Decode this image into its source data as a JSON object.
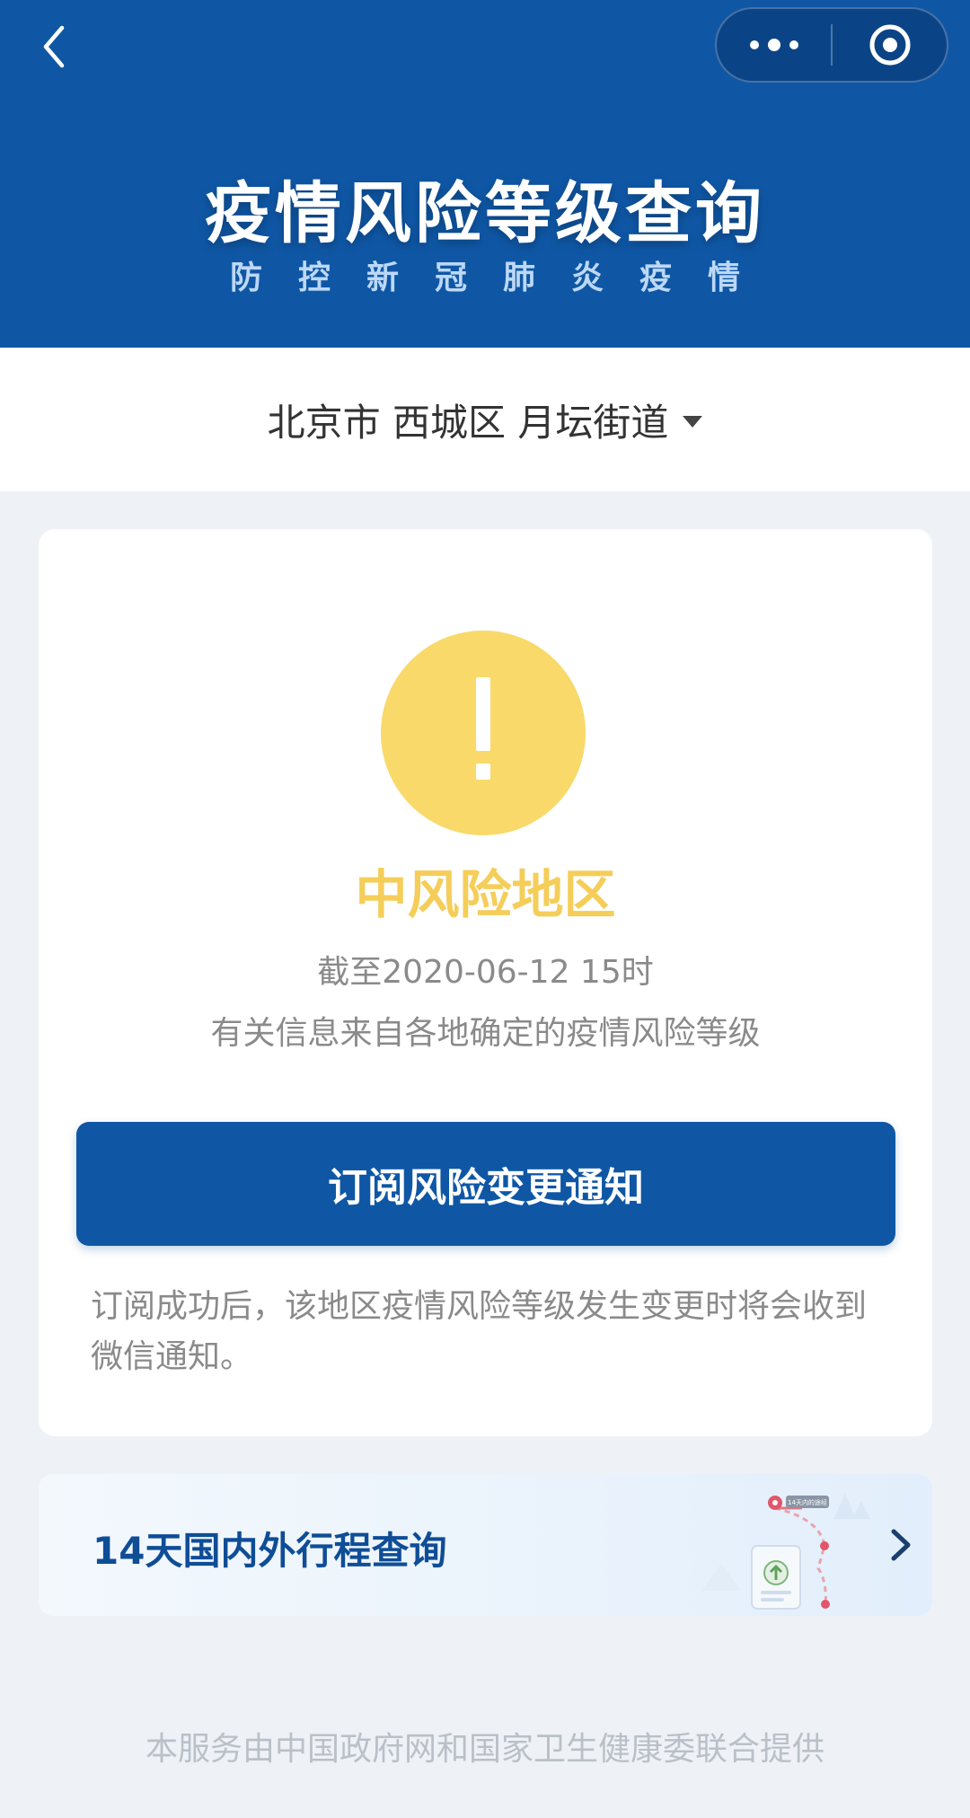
{
  "header": {
    "title": "疫情风险等级查询",
    "subtitle": "防控新冠肺炎疫情"
  },
  "nav": {
    "back_icon": "chevron-left-icon",
    "more_icon": "more-dots-icon",
    "close_icon": "target-circle-icon"
  },
  "region": {
    "label": "北京市 西城区 月坛街道",
    "dropdown_icon": "caret-down-icon"
  },
  "status_card": {
    "icon": "exclamation-icon",
    "risk_level": "中风险地区",
    "update_time": "截至2020-06-12 15时",
    "source_note": "有关信息来自各地确定的疫情风险等级",
    "subscribe_button": "订阅风险变更通知",
    "subscribe_note": "订阅成功后，该地区疫情风险等级发生变更时将会收到微信通知。",
    "colors": {
      "warning": "#f8d96a",
      "risk_text": "#f5cd59",
      "primary": "#0f57a5"
    }
  },
  "trip_card": {
    "title": "14天国内外行程查询",
    "illustration_tag": "14天内的途经",
    "chevron_icon": "chevron-right-icon"
  },
  "footer": {
    "text": "本服务由中国政府网和国家卫生健康委联合提供"
  }
}
